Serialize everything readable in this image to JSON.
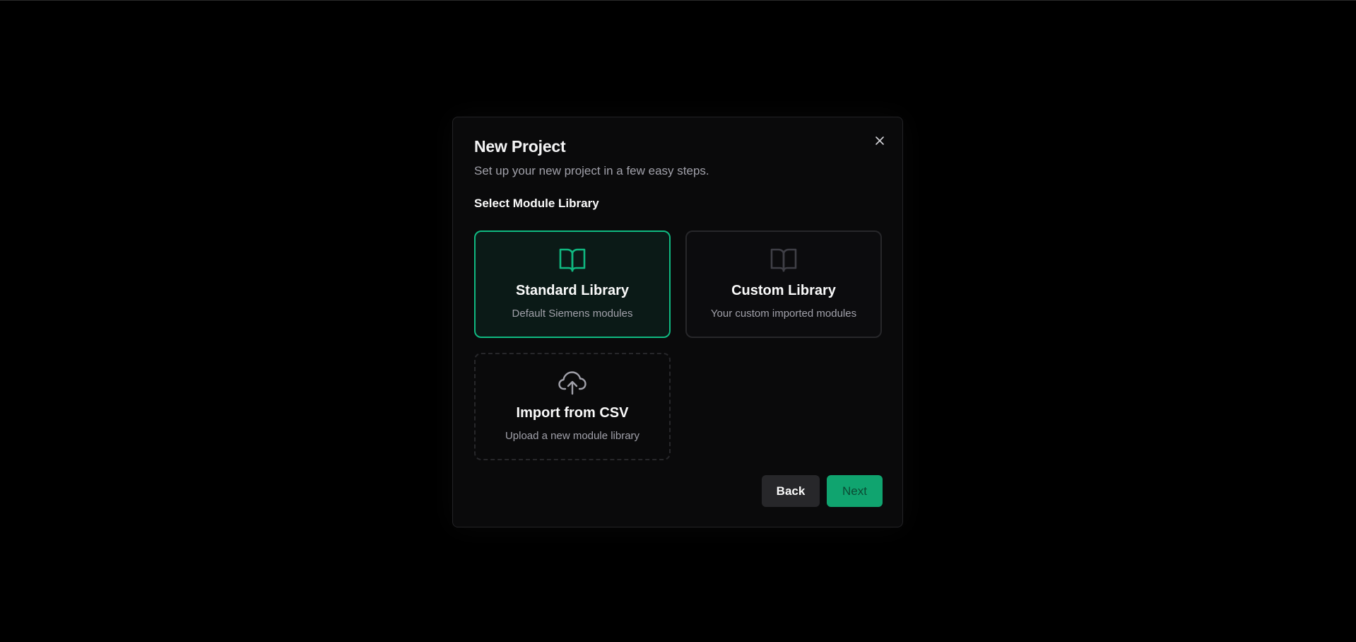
{
  "dialog": {
    "title": "New Project",
    "subtitle": "Set up your new project in a few easy steps.",
    "section_label": "Select Module Library",
    "close_icon": "close-icon"
  },
  "options": [
    {
      "title": "Standard Library",
      "description": "Default Siemens modules",
      "icon": "book-open-icon",
      "selected": true
    },
    {
      "title": "Custom Library",
      "description": "Your custom imported modules",
      "icon": "book-open-icon",
      "selected": false
    },
    {
      "title": "Import from CSV",
      "description": "Upload a new module library",
      "icon": "cloud-upload-icon",
      "selected": false
    }
  ],
  "buttons": {
    "back_label": "Back",
    "next_label": "Next"
  },
  "colors": {
    "accent": "#10b981",
    "background": "#000000",
    "dialog_bg": "#0a0a0b"
  }
}
